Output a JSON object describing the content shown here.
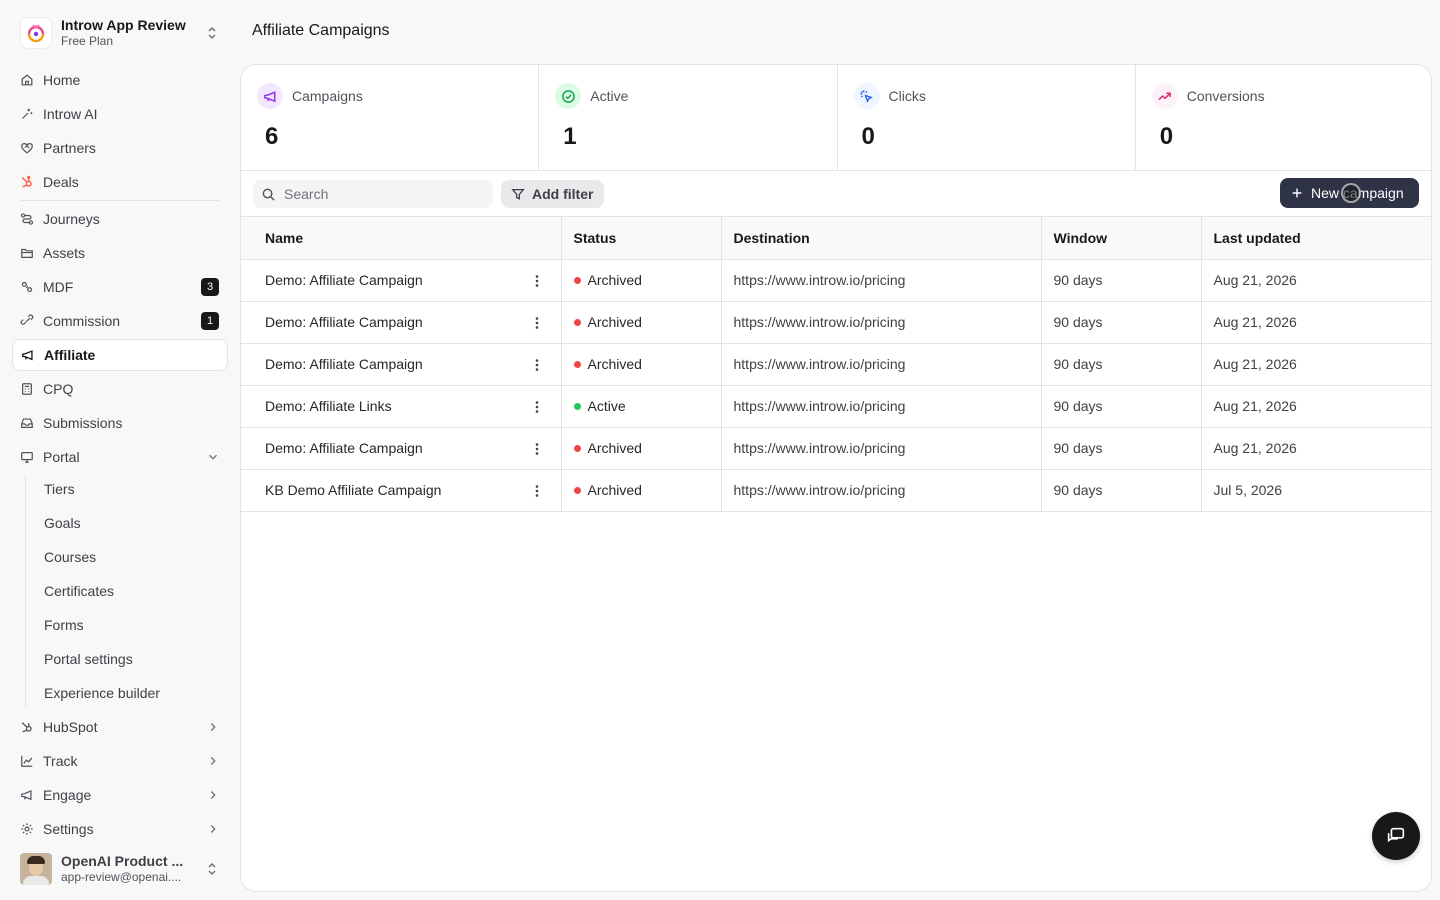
{
  "workspace": {
    "name": "Introw App Review",
    "plan": "Free Plan"
  },
  "nav": {
    "items": [
      {
        "label": "Home",
        "icon": "home-icon"
      },
      {
        "label": "Introw AI",
        "icon": "sparkle-icon"
      },
      {
        "label": "Partners",
        "icon": "handshake-icon"
      },
      {
        "label": "Deals",
        "icon": "hubspot-icon"
      },
      {
        "label": "Journeys",
        "icon": "journey-icon"
      },
      {
        "label": "Assets",
        "icon": "folder-icon"
      },
      {
        "label": "MDF",
        "icon": "percent-icon",
        "badge": "3"
      },
      {
        "label": "Commission",
        "icon": "link-icon",
        "badge": "1"
      },
      {
        "label": "Affiliate",
        "icon": "megaphone-icon",
        "active": true
      },
      {
        "label": "CPQ",
        "icon": "calculator-icon"
      },
      {
        "label": "Submissions",
        "icon": "inbox-icon"
      },
      {
        "label": "Portal",
        "icon": "monitor-icon"
      }
    ],
    "portal_sub": [
      "Tiers",
      "Goals",
      "Courses",
      "Certificates",
      "Forms",
      "Portal settings",
      "Experience builder"
    ],
    "groups": [
      {
        "label": "HubSpot",
        "icon": "hubspot-icon"
      },
      {
        "label": "Track",
        "icon": "chart-icon"
      },
      {
        "label": "Engage",
        "icon": "megaphone-icon"
      },
      {
        "label": "Settings",
        "icon": "gear-icon"
      }
    ]
  },
  "user": {
    "name": "OpenAI Product ...",
    "email": "app-review@openai...."
  },
  "page": {
    "title": "Affiliate Campaigns"
  },
  "stats": [
    {
      "label": "Campaigns",
      "value": "6",
      "icon": "megaphone-icon",
      "color": "#9333ea",
      "bg": "#f3e8ff"
    },
    {
      "label": "Active",
      "value": "1",
      "icon": "check-circle-icon",
      "color": "#16a34a",
      "bg": "#dcfce7"
    },
    {
      "label": "Clicks",
      "value": "0",
      "icon": "cursor-click-icon",
      "color": "#2563eb",
      "bg": "#eff6ff"
    },
    {
      "label": "Conversions",
      "value": "0",
      "icon": "trending-up-icon",
      "color": "#db2777",
      "bg": "#fdf2f8"
    }
  ],
  "toolbar": {
    "search_placeholder": "Search",
    "filter_label": "Add filter",
    "new_label": "New campaign"
  },
  "table": {
    "headers": [
      "Name",
      "Status",
      "Destination",
      "Window",
      "Last updated"
    ],
    "rows": [
      {
        "name": "Demo: Affiliate Campaign",
        "status": "Archived",
        "destination": "https://www.introw.io/pricing",
        "window": "90 days",
        "updated": "Aug 21, 2026"
      },
      {
        "name": "Demo: Affiliate Campaign",
        "status": "Archived",
        "destination": "https://www.introw.io/pricing",
        "window": "90 days",
        "updated": "Aug 21, 2026"
      },
      {
        "name": "Demo: Affiliate Campaign",
        "status": "Archived",
        "destination": "https://www.introw.io/pricing",
        "window": "90 days",
        "updated": "Aug 21, 2026"
      },
      {
        "name": "Demo: Affiliate Links",
        "status": "Active",
        "destination": "https://www.introw.io/pricing",
        "window": "90 days",
        "updated": "Aug 21, 2026"
      },
      {
        "name": "Demo: Affiliate Campaign",
        "status": "Archived",
        "destination": "https://www.introw.io/pricing",
        "window": "90 days",
        "updated": "Aug 21, 2026"
      },
      {
        "name": "KB Demo Affiliate Campaign",
        "status": "Archived",
        "destination": "https://www.introw.io/pricing",
        "window": "90 days",
        "updated": "Jul 5, 2026"
      }
    ]
  },
  "colors": {
    "archived": "#ef4444",
    "active": "#22c55e",
    "primary_button": "#2e3446"
  }
}
